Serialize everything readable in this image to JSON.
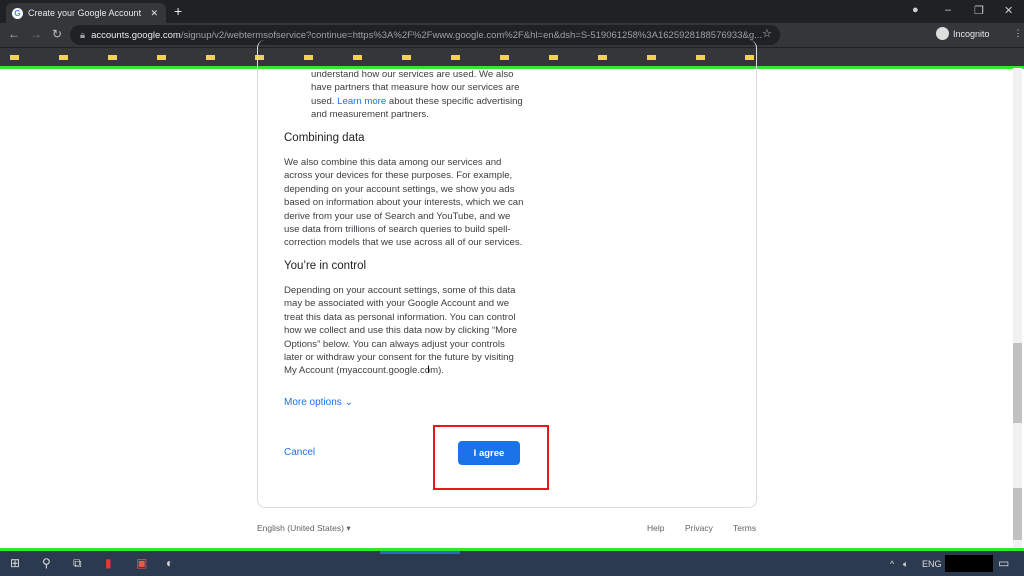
{
  "browser": {
    "tab_title": "Create your Google Account",
    "url_host": "accounts.google.com",
    "url_path": "/signup/v2/webtermsofservice?continue=https%3A%2F%2Fwww.google.com%2F&hl=en&dsh=S-519061258%3A1625928188576933&g...",
    "profile_label": "Incognito",
    "bookmark_count": 16
  },
  "content": {
    "partial_para_1": "understand how our services are used. We also have partners that measure how our services are used.",
    "learn_more": "Learn more",
    "partial_para_2": "about these specific advertising and measurement partners.",
    "combining_heading": "Combining data",
    "combining_text": "We also combine this data among our services and across your devices for these purposes. For example, depending on your account settings, we show you ads based on information about your interests, which we can derive from your use of Search and YouTube, and we use data from trillions of search queries to build spell-correction models that we use across all of our services.",
    "control_heading": "You’re in control",
    "control_text": "Depending on your account settings, some of this data may be associated with your Google Account and we treat this data as personal information. You can control how we collect and use this data now by clicking “More Options” below. You can always adjust your controls later or withdraw your consent for the future by visiting My Account (myaccount.google.com).",
    "more_options": "More options",
    "cancel": "Cancel",
    "agree": "I agree"
  },
  "footer": {
    "language": "English (United States)",
    "help": "Help",
    "privacy": "Privacy",
    "terms": "Terms"
  },
  "taskbar": {
    "language": "ENG"
  },
  "colors": {
    "accent": "#1a73e8",
    "highlight": "#e8161d",
    "green_border": "#2ee82e"
  }
}
